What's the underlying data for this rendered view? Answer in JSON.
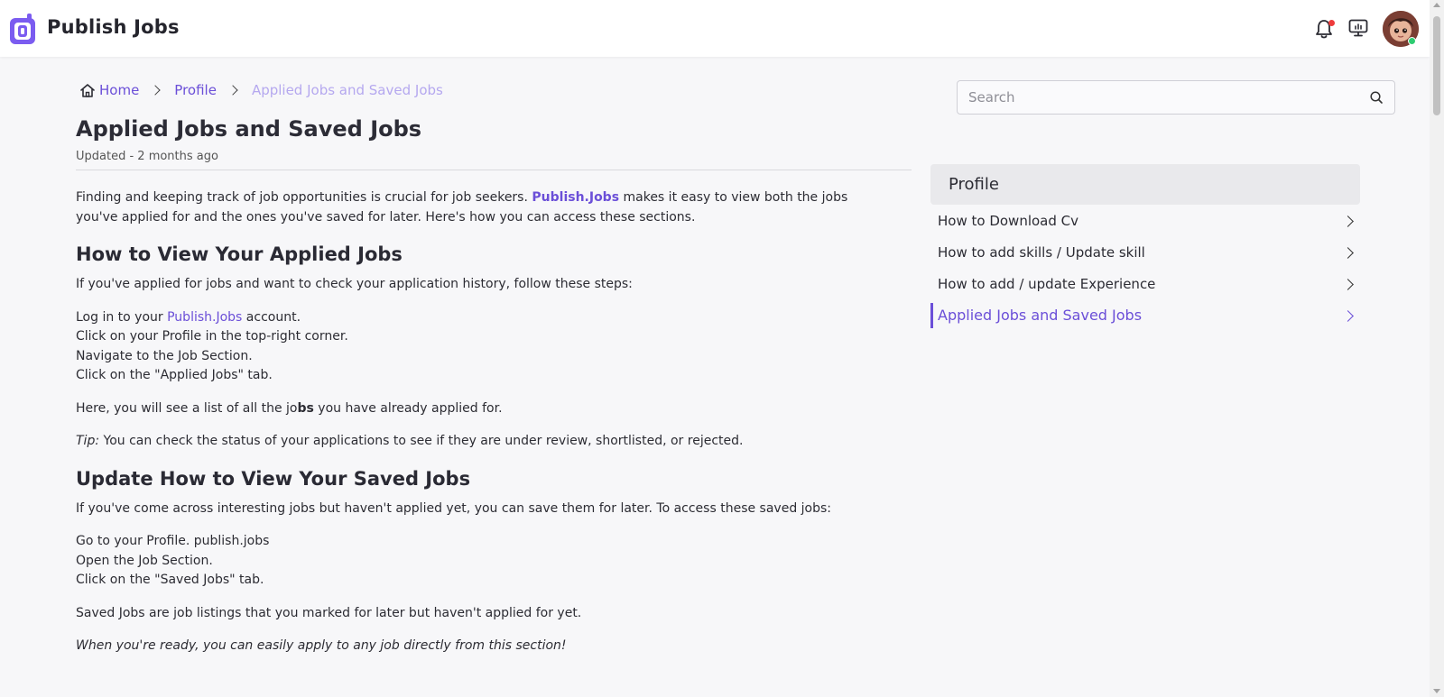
{
  "app": {
    "brand": "Publish Jobs"
  },
  "header": {
    "notifications_icon": "bell-icon",
    "display_icon": "monitor-icon",
    "accent": "#6b4fd8",
    "notification_dot_color": "#ee3b3b",
    "online_color": "#2ecc71"
  },
  "breadcrumb": {
    "home": "Home",
    "profile": "Profile",
    "current": "Applied Jobs and Saved Jobs"
  },
  "article": {
    "title": "Applied Jobs and Saved Jobs",
    "updated": "Updated - 2 months ago",
    "intro_before": "Finding and keeping track of job opportunities is crucial for job seekers. ",
    "intro_brand": "Publish.Jobs",
    "intro_after": " makes it easy to view both the jobs you've applied for and the ones you've saved for later. Here's how you can access these sections.",
    "section1_heading": "How to View Your Applied Jobs",
    "section1_intro": "If you've applied for jobs and want to check your application history, follow these steps:",
    "step1_before": "Log in to your ",
    "step1_link": "Publish.Jobs",
    "step1_after": " account.",
    "step2": "Click on your Profile in the top-right corner.",
    "step3": "Navigate to the Job Section.",
    "step4": "Click on the \"Applied Jobs\" tab.",
    "applied_note_before": "Here, you will see a list of all the jo",
    "applied_note_bold": "bs",
    "applied_note_after": " you have already applied for.",
    "tip_label": "Tip:",
    "tip_text": " You can check the status of your applications to see if they are under review, shortlisted, or rejected.",
    "section2_heading": "Update How to View Your Saved Jobs",
    "section2_intro": "If you've come across interesting jobs but haven't applied yet, you can save them for later. To access these saved jobs:",
    "saved_step1": "Go to your Profile. publish.jobs",
    "saved_step2": "Open the Job Section.",
    "saved_step3": "Click on the \"Saved Jobs\" tab.",
    "saved_note": "Saved Jobs are job listings that you marked for later but haven't applied for yet.",
    "closing": "When you're ready, you can easily apply to any job directly from this section!"
  },
  "search": {
    "placeholder": "Search"
  },
  "sidebar": {
    "header": "Profile",
    "items": [
      {
        "label": "How to Download Cv",
        "active": false
      },
      {
        "label": "How to add skills / Update skill",
        "active": false
      },
      {
        "label": "How to add / update Experience",
        "active": false
      },
      {
        "label": "Applied Jobs and Saved Jobs",
        "active": true
      }
    ]
  }
}
